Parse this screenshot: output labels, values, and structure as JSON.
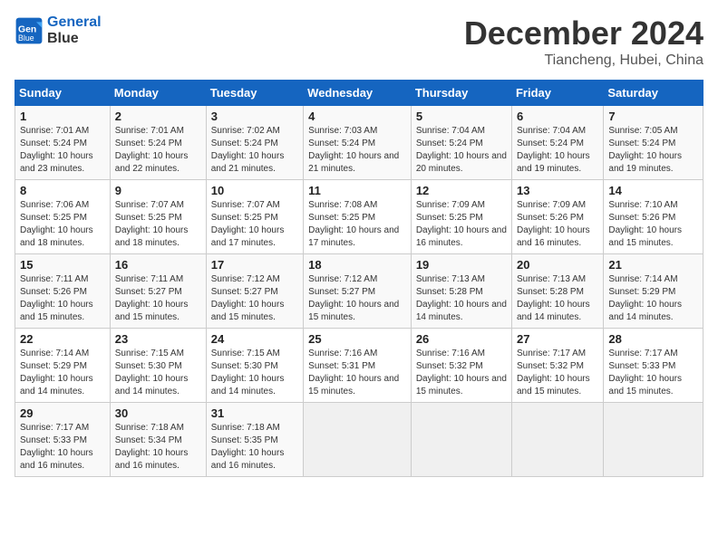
{
  "logo": {
    "line1": "General",
    "line2": "Blue"
  },
  "title": "December 2024",
  "location": "Tiancheng, Hubei, China",
  "days_of_week": [
    "Sunday",
    "Monday",
    "Tuesday",
    "Wednesday",
    "Thursday",
    "Friday",
    "Saturday"
  ],
  "weeks": [
    [
      {
        "day": "1",
        "sunrise": "Sunrise: 7:01 AM",
        "sunset": "Sunset: 5:24 PM",
        "daylight": "Daylight: 10 hours and 23 minutes."
      },
      {
        "day": "2",
        "sunrise": "Sunrise: 7:01 AM",
        "sunset": "Sunset: 5:24 PM",
        "daylight": "Daylight: 10 hours and 22 minutes."
      },
      {
        "day": "3",
        "sunrise": "Sunrise: 7:02 AM",
        "sunset": "Sunset: 5:24 PM",
        "daylight": "Daylight: 10 hours and 21 minutes."
      },
      {
        "day": "4",
        "sunrise": "Sunrise: 7:03 AM",
        "sunset": "Sunset: 5:24 PM",
        "daylight": "Daylight: 10 hours and 21 minutes."
      },
      {
        "day": "5",
        "sunrise": "Sunrise: 7:04 AM",
        "sunset": "Sunset: 5:24 PM",
        "daylight": "Daylight: 10 hours and 20 minutes."
      },
      {
        "day": "6",
        "sunrise": "Sunrise: 7:04 AM",
        "sunset": "Sunset: 5:24 PM",
        "daylight": "Daylight: 10 hours and 19 minutes."
      },
      {
        "day": "7",
        "sunrise": "Sunrise: 7:05 AM",
        "sunset": "Sunset: 5:24 PM",
        "daylight": "Daylight: 10 hours and 19 minutes."
      }
    ],
    [
      {
        "day": "8",
        "sunrise": "Sunrise: 7:06 AM",
        "sunset": "Sunset: 5:25 PM",
        "daylight": "Daylight: 10 hours and 18 minutes."
      },
      {
        "day": "9",
        "sunrise": "Sunrise: 7:07 AM",
        "sunset": "Sunset: 5:25 PM",
        "daylight": "Daylight: 10 hours and 18 minutes."
      },
      {
        "day": "10",
        "sunrise": "Sunrise: 7:07 AM",
        "sunset": "Sunset: 5:25 PM",
        "daylight": "Daylight: 10 hours and 17 minutes."
      },
      {
        "day": "11",
        "sunrise": "Sunrise: 7:08 AM",
        "sunset": "Sunset: 5:25 PM",
        "daylight": "Daylight: 10 hours and 17 minutes."
      },
      {
        "day": "12",
        "sunrise": "Sunrise: 7:09 AM",
        "sunset": "Sunset: 5:25 PM",
        "daylight": "Daylight: 10 hours and 16 minutes."
      },
      {
        "day": "13",
        "sunrise": "Sunrise: 7:09 AM",
        "sunset": "Sunset: 5:26 PM",
        "daylight": "Daylight: 10 hours and 16 minutes."
      },
      {
        "day": "14",
        "sunrise": "Sunrise: 7:10 AM",
        "sunset": "Sunset: 5:26 PM",
        "daylight": "Daylight: 10 hours and 15 minutes."
      }
    ],
    [
      {
        "day": "15",
        "sunrise": "Sunrise: 7:11 AM",
        "sunset": "Sunset: 5:26 PM",
        "daylight": "Daylight: 10 hours and 15 minutes."
      },
      {
        "day": "16",
        "sunrise": "Sunrise: 7:11 AM",
        "sunset": "Sunset: 5:27 PM",
        "daylight": "Daylight: 10 hours and 15 minutes."
      },
      {
        "day": "17",
        "sunrise": "Sunrise: 7:12 AM",
        "sunset": "Sunset: 5:27 PM",
        "daylight": "Daylight: 10 hours and 15 minutes."
      },
      {
        "day": "18",
        "sunrise": "Sunrise: 7:12 AM",
        "sunset": "Sunset: 5:27 PM",
        "daylight": "Daylight: 10 hours and 15 minutes."
      },
      {
        "day": "19",
        "sunrise": "Sunrise: 7:13 AM",
        "sunset": "Sunset: 5:28 PM",
        "daylight": "Daylight: 10 hours and 14 minutes."
      },
      {
        "day": "20",
        "sunrise": "Sunrise: 7:13 AM",
        "sunset": "Sunset: 5:28 PM",
        "daylight": "Daylight: 10 hours and 14 minutes."
      },
      {
        "day": "21",
        "sunrise": "Sunrise: 7:14 AM",
        "sunset": "Sunset: 5:29 PM",
        "daylight": "Daylight: 10 hours and 14 minutes."
      }
    ],
    [
      {
        "day": "22",
        "sunrise": "Sunrise: 7:14 AM",
        "sunset": "Sunset: 5:29 PM",
        "daylight": "Daylight: 10 hours and 14 minutes."
      },
      {
        "day": "23",
        "sunrise": "Sunrise: 7:15 AM",
        "sunset": "Sunset: 5:30 PM",
        "daylight": "Daylight: 10 hours and 14 minutes."
      },
      {
        "day": "24",
        "sunrise": "Sunrise: 7:15 AM",
        "sunset": "Sunset: 5:30 PM",
        "daylight": "Daylight: 10 hours and 14 minutes."
      },
      {
        "day": "25",
        "sunrise": "Sunrise: 7:16 AM",
        "sunset": "Sunset: 5:31 PM",
        "daylight": "Daylight: 10 hours and 15 minutes."
      },
      {
        "day": "26",
        "sunrise": "Sunrise: 7:16 AM",
        "sunset": "Sunset: 5:32 PM",
        "daylight": "Daylight: 10 hours and 15 minutes."
      },
      {
        "day": "27",
        "sunrise": "Sunrise: 7:17 AM",
        "sunset": "Sunset: 5:32 PM",
        "daylight": "Daylight: 10 hours and 15 minutes."
      },
      {
        "day": "28",
        "sunrise": "Sunrise: 7:17 AM",
        "sunset": "Sunset: 5:33 PM",
        "daylight": "Daylight: 10 hours and 15 minutes."
      }
    ],
    [
      {
        "day": "29",
        "sunrise": "Sunrise: 7:17 AM",
        "sunset": "Sunset: 5:33 PM",
        "daylight": "Daylight: 10 hours and 16 minutes."
      },
      {
        "day": "30",
        "sunrise": "Sunrise: 7:18 AM",
        "sunset": "Sunset: 5:34 PM",
        "daylight": "Daylight: 10 hours and 16 minutes."
      },
      {
        "day": "31",
        "sunrise": "Sunrise: 7:18 AM",
        "sunset": "Sunset: 5:35 PM",
        "daylight": "Daylight: 10 hours and 16 minutes."
      },
      null,
      null,
      null,
      null
    ]
  ]
}
